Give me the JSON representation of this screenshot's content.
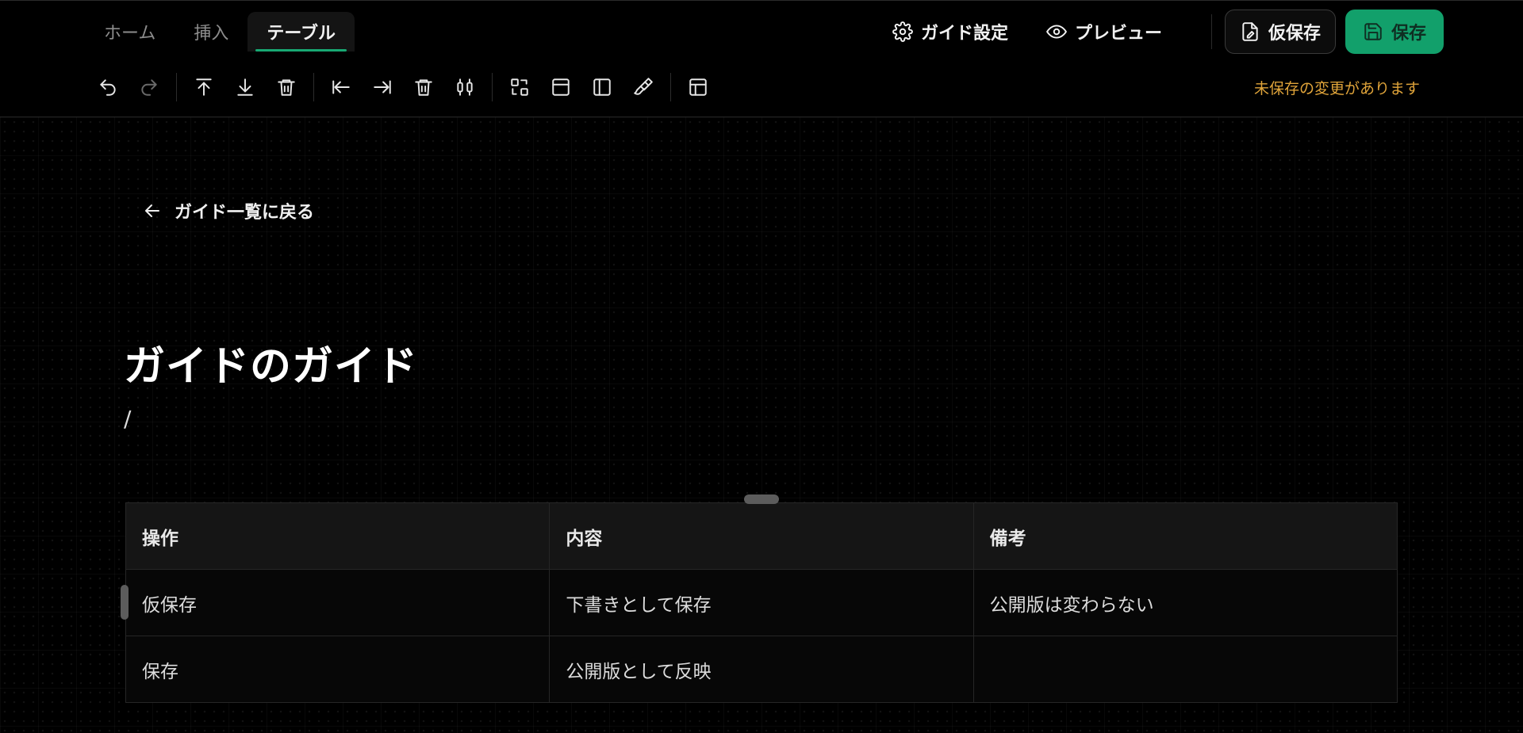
{
  "tabs": [
    {
      "label": "ホーム",
      "active": false
    },
    {
      "label": "挿入",
      "active": false
    },
    {
      "label": "テーブル",
      "active": true
    }
  ],
  "header": {
    "guide_settings_label": "ガイド設定",
    "preview_label": "プレビュー",
    "draft_save_label": "仮保存",
    "save_label": "保存"
  },
  "toolbar": {
    "buttons": [
      {
        "icon": "undo-icon"
      },
      {
        "icon": "redo-icon"
      },
      {
        "icon": "insert-row-above-icon"
      },
      {
        "icon": "insert-row-below-icon"
      },
      {
        "icon": "delete-row-icon"
      },
      {
        "icon": "insert-column-left-icon"
      },
      {
        "icon": "insert-column-right-icon"
      },
      {
        "icon": "delete-column-icon"
      },
      {
        "icon": "column-width-icon"
      },
      {
        "icon": "merge-cells-icon"
      },
      {
        "icon": "header-row-icon"
      },
      {
        "icon": "header-column-icon"
      },
      {
        "icon": "cell-color-brush-icon"
      },
      {
        "icon": "table-settings-icon"
      }
    ],
    "status_text": "未保存の変更があります"
  },
  "colors": {
    "accent": "#12a06b",
    "warning": "#e0a43a",
    "background": "#000000"
  },
  "content": {
    "back_link_label": "ガイド一覧に戻る",
    "title": "ガイドのガイド",
    "body_text": "/"
  },
  "table": {
    "headers": [
      "操作",
      "内容",
      "備考"
    ],
    "rows": [
      [
        "仮保存",
        "下書きとして保存",
        "公開版は変わらない"
      ],
      [
        "保存",
        "公開版として反映",
        ""
      ]
    ]
  }
}
